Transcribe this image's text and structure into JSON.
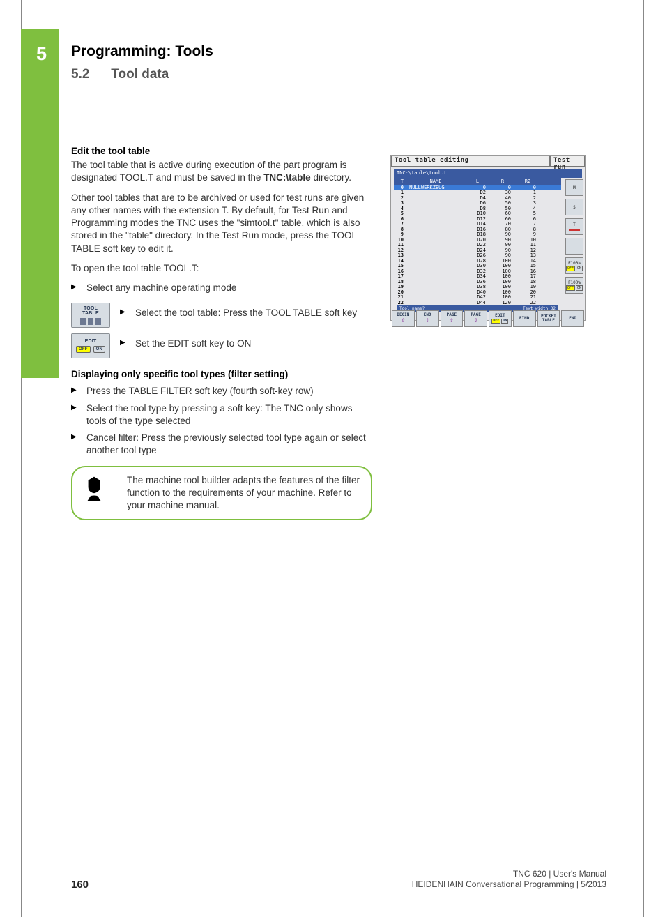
{
  "header": {
    "chapter_num": "5",
    "chapter_title": "Programming: Tools",
    "section_num": "5.2",
    "section_title": "Tool data"
  },
  "body": {
    "h_edit": "Edit the tool table",
    "p1a": "The tool table that is active during execution of the part program is designated TOOL.T and must be saved in the ",
    "p1b": "TNC:\\table",
    "p1c": " directory.",
    "p2": "Other tool tables that are to be archived or used for test runs are given any other names with the extension T. By default, for Test Run and Programming modes the TNC uses the \"simtool.t\" table, which is also stored in the \"table\" directory. In the Test Run mode, press the TOOL TABLE soft key to edit it.",
    "p3": "To open the tool table TOOL.T:",
    "b1": "Select any machine operating mode",
    "sk1_l1": "TOOL",
    "sk1_l2": "TABLE",
    "sk2_l1": "EDIT",
    "sk_off": "OFF",
    "sk_on": "ON",
    "sb1": "Select the tool table: Press the TOOL TABLE soft key",
    "sb2": "Set the EDIT soft key to ON",
    "h_filter": "Displaying only specific tool types (filter setting)",
    "f1": "Press the TABLE FILTER soft key (fourth soft-key row)",
    "f2": "Select the tool type by pressing a soft key: The TNC only shows tools of the type selected",
    "f3": "Cancel filter: Press the previously selected tool type again or select another tool type",
    "note": "The machine tool builder adapts the features of the filter function to the requirements of your machine. Refer to your machine manual."
  },
  "screenshot": {
    "title_main": "Tool table editing",
    "title_side": "Test run",
    "path": "TNC:\\table\\tool.t",
    "cols": {
      "t": "T",
      "name": "NAME",
      "l": "L",
      "r": "R",
      "r2": "R2"
    },
    "rows": [
      {
        "t": "0",
        "name": "NULLWERKZEUG",
        "l": "0",
        "r": "0",
        "r2": "0",
        "hl": true
      },
      {
        "t": "1",
        "name": "",
        "l": "D2",
        "r": "30",
        "r2": "1"
      },
      {
        "t": "2",
        "name": "",
        "l": "D4",
        "r": "40",
        "r2": "2"
      },
      {
        "t": "3",
        "name": "",
        "l": "D6",
        "r": "50",
        "r2": "3"
      },
      {
        "t": "4",
        "name": "",
        "l": "D8",
        "r": "50",
        "r2": "4"
      },
      {
        "t": "5",
        "name": "",
        "l": "D10",
        "r": "60",
        "r2": "5"
      },
      {
        "t": "6",
        "name": "",
        "l": "D12",
        "r": "60",
        "r2": "6"
      },
      {
        "t": "7",
        "name": "",
        "l": "D14",
        "r": "70",
        "r2": "7"
      },
      {
        "t": "8",
        "name": "",
        "l": "D16",
        "r": "80",
        "r2": "8"
      },
      {
        "t": "9",
        "name": "",
        "l": "D18",
        "r": "90",
        "r2": "9"
      },
      {
        "t": "10",
        "name": "",
        "l": "D20",
        "r": "90",
        "r2": "10"
      },
      {
        "t": "11",
        "name": "",
        "l": "D22",
        "r": "90",
        "r2": "11"
      },
      {
        "t": "12",
        "name": "",
        "l": "D24",
        "r": "90",
        "r2": "12"
      },
      {
        "t": "13",
        "name": "",
        "l": "D26",
        "r": "90",
        "r2": "13"
      },
      {
        "t": "14",
        "name": "",
        "l": "D28",
        "r": "100",
        "r2": "14"
      },
      {
        "t": "15",
        "name": "",
        "l": "D30",
        "r": "100",
        "r2": "15"
      },
      {
        "t": "16",
        "name": "",
        "l": "D32",
        "r": "100",
        "r2": "16"
      },
      {
        "t": "17",
        "name": "",
        "l": "D34",
        "r": "100",
        "r2": "17"
      },
      {
        "t": "18",
        "name": "",
        "l": "D36",
        "r": "100",
        "r2": "18"
      },
      {
        "t": "19",
        "name": "",
        "l": "D38",
        "r": "100",
        "r2": "19"
      },
      {
        "t": "20",
        "name": "",
        "l": "D40",
        "r": "100",
        "r2": "20"
      },
      {
        "t": "21",
        "name": "",
        "l": "D42",
        "r": "100",
        "r2": "21"
      },
      {
        "t": "22",
        "name": "",
        "l": "D44",
        "r": "120",
        "r2": "22"
      }
    ],
    "status_l": "Tool name?",
    "status_r": "Text width 32",
    "softkeys": [
      {
        "l1": "BEGIN",
        "arrow": "⇧"
      },
      {
        "l1": "END",
        "arrow": "⇩"
      },
      {
        "l1": "PAGE",
        "arrow": "⇧"
      },
      {
        "l1": "PAGE",
        "arrow": "⇩"
      },
      {
        "l1": "EDIT",
        "off": "OFF",
        "on": "ON"
      },
      {
        "l1": "FIND"
      },
      {
        "l1": "POCKET",
        "l2": "TABLE"
      },
      {
        "l1": "END"
      }
    ],
    "side_btns": [
      {
        "label": "M"
      },
      {
        "label": "S"
      },
      {
        "label": "T",
        "red": true
      },
      {
        "label": ""
      },
      {
        "label": "F100%",
        "offon": true
      },
      {
        "label": "F100%",
        "offon": true
      }
    ]
  },
  "footer": {
    "page": "160",
    "line1": "TNC 620 | User's Manual",
    "line2": "HEIDENHAIN Conversational Programming | 5/2013"
  }
}
